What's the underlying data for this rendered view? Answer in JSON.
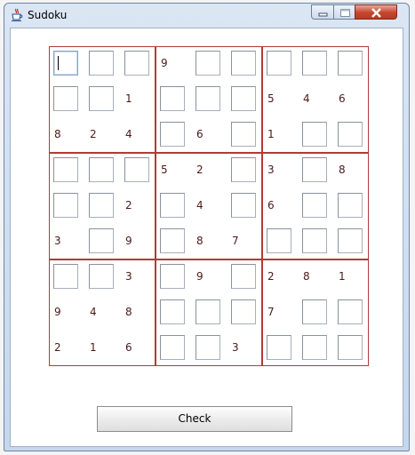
{
  "window": {
    "title": "Sudoku",
    "icon": "java-cup-icon",
    "accent": "#b23a3a"
  },
  "controls": {
    "minimize_icon": "minimize-icon",
    "maximize_icon": "maximize-icon",
    "close_icon": "close-icon"
  },
  "board": {
    "focused_cell": [
      0,
      0
    ],
    "grid": [
      [
        "",
        "",
        "",
        "9",
        "",
        "",
        "",
        "",
        ""
      ],
      [
        "",
        "",
        "1",
        "",
        "",
        "",
        "5",
        "4",
        "6"
      ],
      [
        "8",
        "2",
        "4",
        "",
        "6",
        "",
        "1",
        "",
        ""
      ],
      [
        "",
        "",
        "",
        "5",
        "2",
        "",
        "3",
        "",
        "8"
      ],
      [
        "",
        "",
        "2",
        "",
        "4",
        "",
        "6",
        "",
        ""
      ],
      [
        "3",
        "",
        "9",
        "",
        "8",
        "7",
        "",
        "",
        ""
      ],
      [
        "",
        "",
        "3",
        "",
        "9",
        "",
        "2",
        "8",
        "1"
      ],
      [
        "9",
        "4",
        "8",
        "",
        "",
        "",
        "7",
        "",
        ""
      ],
      [
        "2",
        "1",
        "6",
        "",
        "",
        "3",
        "",
        "",
        ""
      ]
    ]
  },
  "actions": {
    "check_label": "Check"
  }
}
